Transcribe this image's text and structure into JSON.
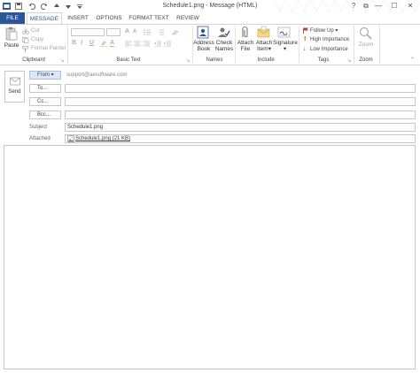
{
  "window": {
    "title": "Schedule1.png - Message (HTML)",
    "controls": {
      "help": "?",
      "ribbon_display": "⧉",
      "minimize": "—",
      "maximize": "☐",
      "close": "✕"
    }
  },
  "tabs": [
    {
      "label": "FILE"
    },
    {
      "label": "MESSAGE"
    },
    {
      "label": "INSERT"
    },
    {
      "label": "OPTIONS"
    },
    {
      "label": "FORMAT TEXT"
    },
    {
      "label": "REVIEW"
    }
  ],
  "ribbon": {
    "clipboard": {
      "label": "Clipboard",
      "paste": "Paste",
      "cut": "Cut",
      "copy": "Copy",
      "format_painter": "Format Painter"
    },
    "basic_text": {
      "label": "Basic Text",
      "bold": "B",
      "italic": "I",
      "underline": "U",
      "font_color": "A",
      "grow": "A",
      "shrink": "A"
    },
    "names": {
      "label": "Names",
      "address_book_1": "Address",
      "address_book_2": "Book",
      "check_names_1": "Check",
      "check_names_2": "Names"
    },
    "include": {
      "label": "Include",
      "attach_file_1": "Attach",
      "attach_file_2": "File",
      "attach_item_1": "Attach",
      "attach_item_2": "Item",
      "signature_1": "Signature",
      "signature_2": ""
    },
    "tags": {
      "label": "Tags",
      "follow_up": "Follow Up",
      "high_importance": "High Importance",
      "low_importance": "Low Importance"
    },
    "zoom": {
      "label": "Zoom"
    }
  },
  "compose": {
    "send": "Send",
    "from_label": "From",
    "from_value": "support@aesoftware.com",
    "to_label": "To...",
    "cc_label": "Cc...",
    "bcc_label": "Bcc...",
    "subject_label": "Subject",
    "subject_value": "Schedule1.png",
    "attached_label": "Attached",
    "attachment_name": "Schedule1.png (21 KB)"
  },
  "colors": {
    "accent": "#2b579a",
    "from_button": "#dbe8f6",
    "flag": "#c0392b",
    "importance_high": "#c0392b",
    "importance_low": "#2b579a"
  }
}
